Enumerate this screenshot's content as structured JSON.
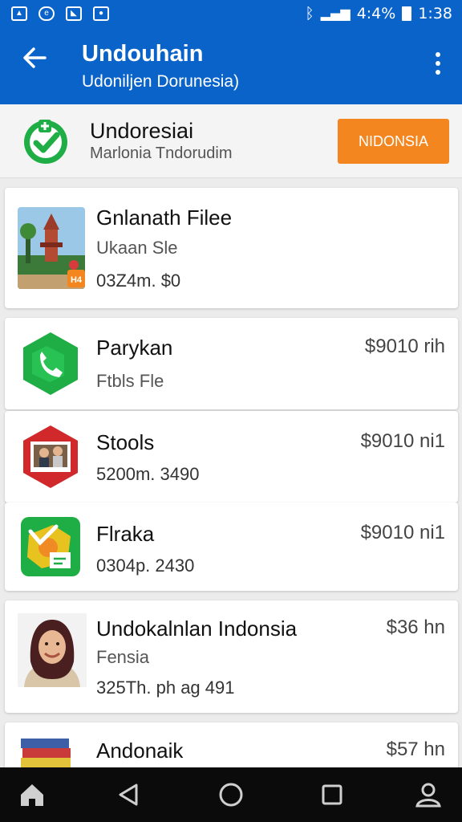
{
  "status_bar": {
    "battery": "4:4%",
    "time": "1:38"
  },
  "app_bar": {
    "title": "Undouhain",
    "subtitle": "Udoniljen Dorunesia)"
  },
  "banner": {
    "title": "Undoresiai",
    "subtitle": "Marlonia Tndorudim",
    "button_label": "NIDONSIA"
  },
  "items": [
    {
      "title": "Gnlanath Filee",
      "subtitle": "Ukaan Sle",
      "meta": "03Z4m. $0",
      "price": "",
      "thumb_badge": "H4",
      "thumb_icon": "temple-photo"
    },
    {
      "title": "Parykan",
      "subtitle": "Ftbls Fle",
      "meta": "",
      "price": "$9010 rih",
      "thumb_icon": "phone-icon"
    },
    {
      "title": "Stools",
      "subtitle": "",
      "meta": "5200m. 3490",
      "price": "$9010 ni1",
      "thumb_icon": "photo-icon"
    },
    {
      "title": "Flraka",
      "subtitle": "",
      "meta": "0304p. 2430",
      "price": "$9010 ni1",
      "thumb_icon": "map-icon"
    },
    {
      "title": "Undokalnlan Indonsia",
      "subtitle": "Fensia",
      "meta": "325Th. ph ag 491",
      "price": "$36 hn",
      "thumb_icon": "person-photo"
    },
    {
      "title": "Andonaik",
      "subtitle": "",
      "meta": "",
      "price": "$57 hn",
      "thumb_icon": "books-icon"
    }
  ],
  "colors": {
    "primary": "#0a63c9",
    "accent": "#f4861f",
    "nav_bar": "#0b0b0b"
  }
}
